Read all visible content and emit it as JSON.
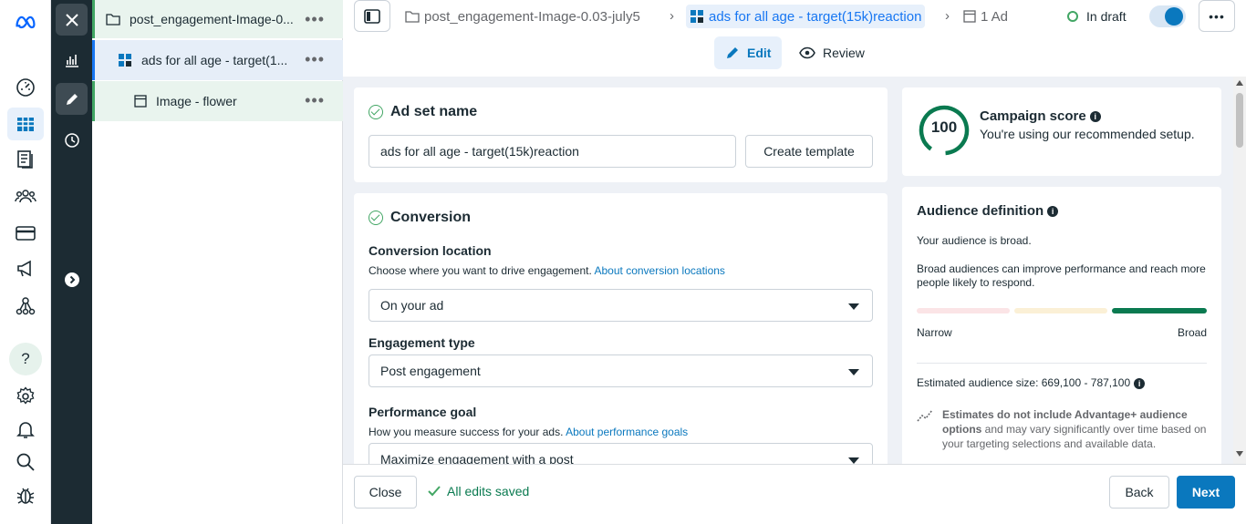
{
  "rail": {
    "items": [
      "meta-logo-icon",
      "dashboard-icon",
      "table-icon",
      "pages-icon",
      "audience-icon",
      "billing-icon",
      "megaphone-icon",
      "network-icon",
      "help-icon",
      "settings-icon",
      "bell-icon",
      "search-icon",
      "bug-icon"
    ],
    "help_glyph": "?"
  },
  "tree": {
    "campaign": "post_engagement-Image-0...",
    "adset": "ads for all age - target(1...",
    "ad": "Image - flower",
    "dots": "•••"
  },
  "header": {
    "campaign_crumb": "post_engagement-Image-0.03-july5",
    "adset_crumb": "ads for all age - target(15k)reaction",
    "ad_crumb": "1 Ad",
    "chevron": "›",
    "status": "In draft",
    "more": "•••",
    "tabs": {
      "edit": "Edit",
      "review": "Review"
    }
  },
  "adset_name": {
    "title": "Ad set name",
    "value": "ads for all age - target(15k)reaction",
    "template_btn": "Create template"
  },
  "conversion": {
    "title": "Conversion",
    "location_label": "Conversion location",
    "location_help": "Choose where you want to drive engagement.",
    "location_link": "About conversion locations",
    "location_value": "On your ad",
    "engagement_label": "Engagement type",
    "engagement_value": "Post engagement",
    "goal_label": "Performance goal",
    "goal_help": "How you measure success for your ads.",
    "goal_link": "About performance goals",
    "goal_value": "Maximize engagement with a post"
  },
  "score": {
    "value": "100",
    "title": "Campaign score",
    "subtitle": "You're using our recommended setup.",
    "color": "#0a7a50"
  },
  "audience": {
    "title": "Audience definition",
    "state": "Your audience is broad.",
    "desc": "Broad audiences can improve performance and reach more people likely to respond.",
    "narrow": "Narrow",
    "broad": "Broad",
    "size_label": "Estimated audience size: 669,100 - 787,100",
    "note_bold": "Estimates do not include Advantage+ audience options",
    "note_rest": " and may vary significantly over time based on your targeting selections and available data."
  },
  "footer": {
    "close": "Close",
    "saved": "All edits saved",
    "back": "Back",
    "next": "Next",
    "accent": "#0a78be"
  }
}
